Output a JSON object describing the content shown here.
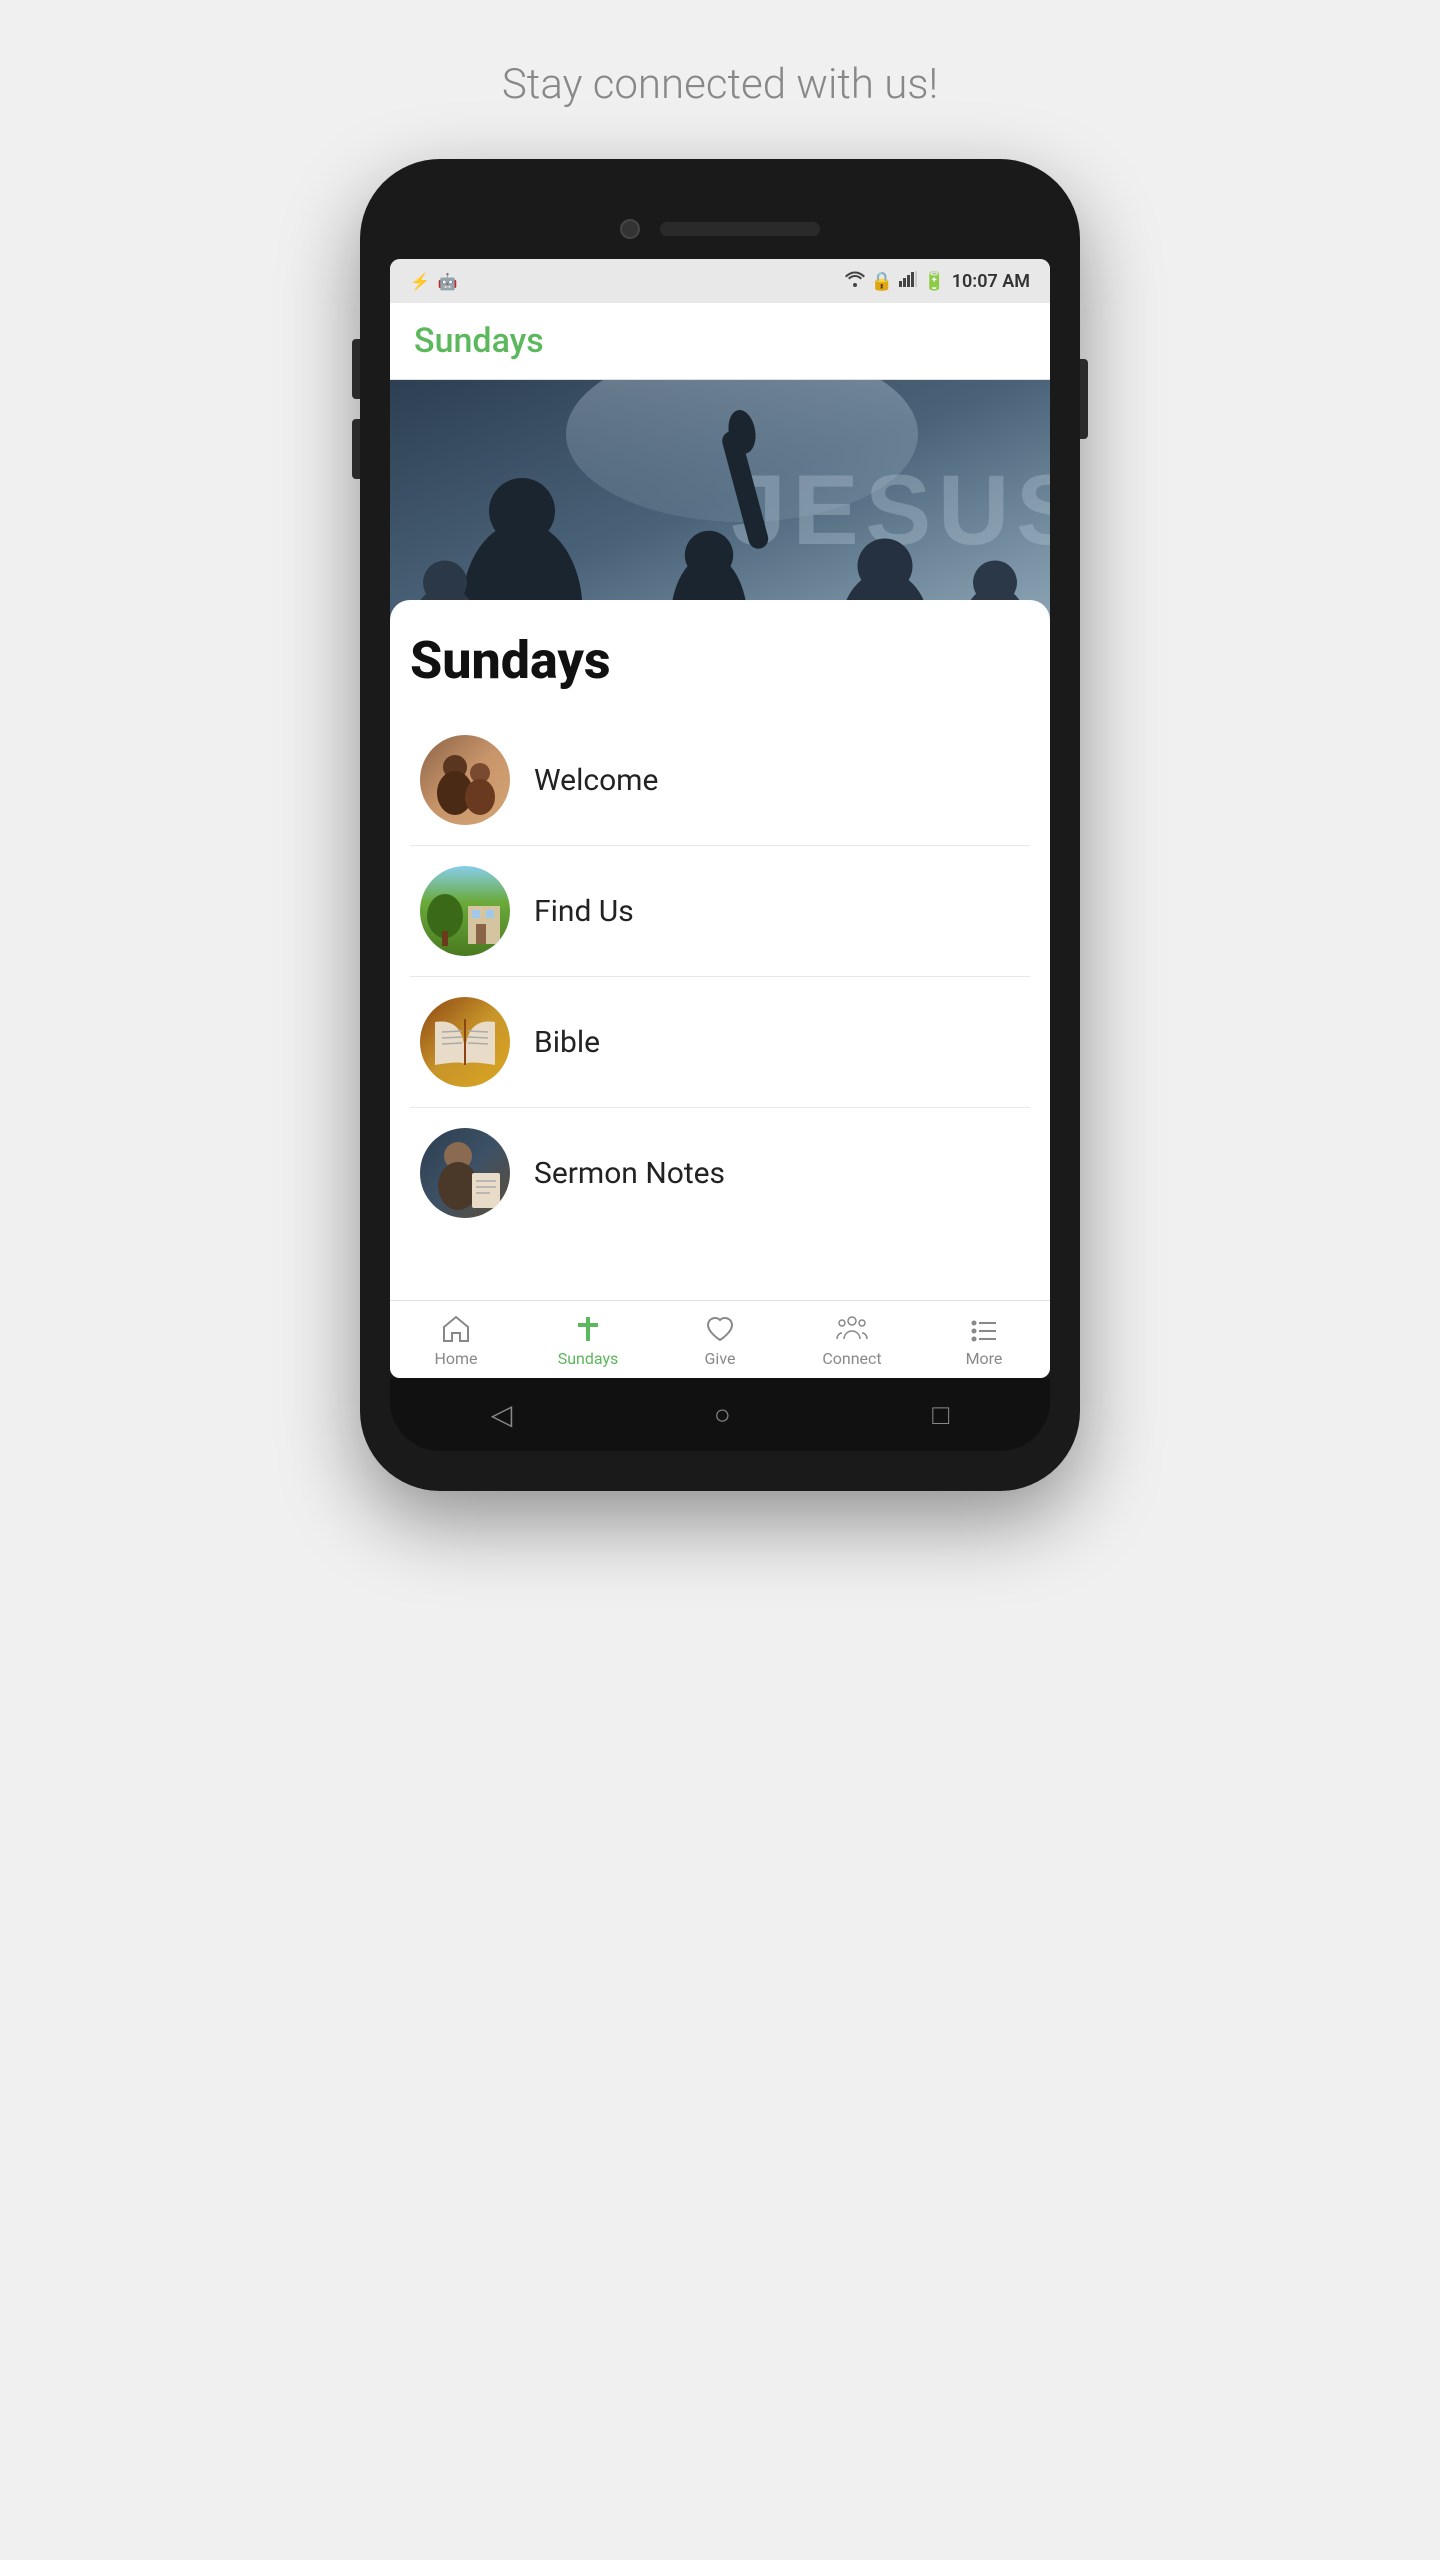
{
  "page": {
    "tagline": "Stay connected with us!"
  },
  "status_bar": {
    "time": "10:07 AM",
    "icons_left": [
      "usb-icon",
      "android-icon"
    ],
    "icons_right": [
      "wifi-icon",
      "lock-icon",
      "signal-icon",
      "battery-icon"
    ]
  },
  "app_header": {
    "title": "Sundays"
  },
  "hero": {
    "text_watermark": "JESUS"
  },
  "content": {
    "title": "Sundays",
    "items": [
      {
        "label": "Welcome",
        "avatar_type": "welcome"
      },
      {
        "label": "Find Us",
        "avatar_type": "findus"
      },
      {
        "label": "Bible",
        "avatar_type": "bible"
      },
      {
        "label": "Sermon Notes",
        "avatar_type": "sermon"
      }
    ]
  },
  "bottom_nav": {
    "items": [
      {
        "id": "home",
        "label": "Home",
        "active": false
      },
      {
        "id": "sundays",
        "label": "Sundays",
        "active": true
      },
      {
        "id": "give",
        "label": "Give",
        "active": false
      },
      {
        "id": "connect",
        "label": "Connect",
        "active": false
      },
      {
        "id": "more",
        "label": "More",
        "active": false
      }
    ]
  },
  "gesture_bar": {
    "back_label": "◁",
    "home_label": "○",
    "recent_label": "□"
  }
}
